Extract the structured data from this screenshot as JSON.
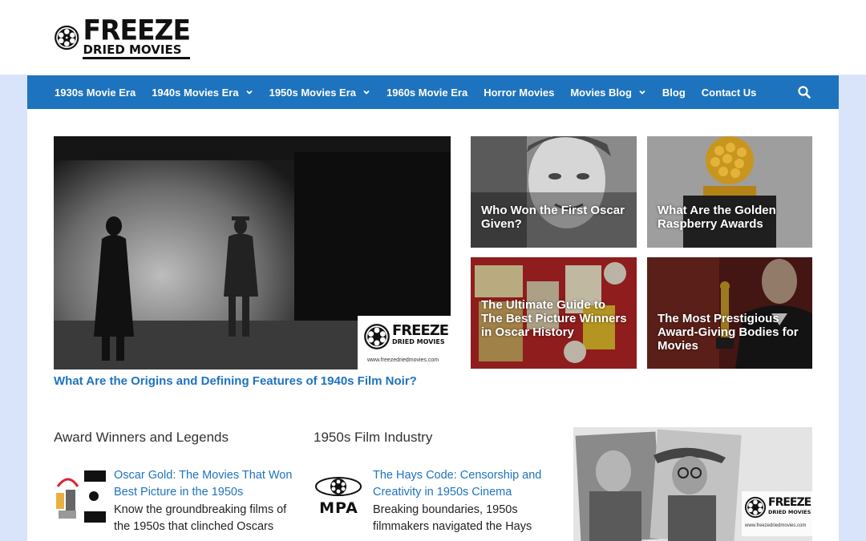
{
  "header": {
    "logo_line1": "FREEZE",
    "logo_line2": "DRIED MOVIES"
  },
  "nav": {
    "items": [
      {
        "label": "1930s Movie Era",
        "dropdown": false
      },
      {
        "label": "1940s Movies Era",
        "dropdown": true
      },
      {
        "label": "1950s Movies Era",
        "dropdown": true
      },
      {
        "label": "1960s Movie Era",
        "dropdown": false
      },
      {
        "label": "Horror Movies",
        "dropdown": false
      },
      {
        "label": "Movies Blog",
        "dropdown": true
      },
      {
        "label": "Blog",
        "dropdown": false
      },
      {
        "label": "Contact Us",
        "dropdown": false
      }
    ],
    "search_icon": "search-icon"
  },
  "featured": {
    "main": {
      "title": "What Are the Origins and Defining Features of 1940s Film Noir?",
      "watermark_line1": "FREEZE",
      "watermark_line2": "DRIED MOVIES",
      "watermark_url": "www.freezedriedmovies.com"
    },
    "tiles": [
      {
        "label": "Who Won the First Oscar Given?"
      },
      {
        "label": "What Are the Golden Raspberry Awards"
      },
      {
        "label": "The Ultimate Guide to The Best Picture Winners in Oscar History"
      },
      {
        "label": "The Most Prestigious Award-Giving Bodies for Movies"
      }
    ]
  },
  "sections": [
    {
      "title": "Award Winners and Legends",
      "post": {
        "title": "Oscar Gold: The Movies That Won Best Picture in the 1950s",
        "excerpt": "Know the groundbreaking films of the 1950s that clinched Oscars"
      }
    },
    {
      "title": "1950s Film Industry",
      "post": {
        "title": "The Hays Code: Censorship and Creativity in 1950s Cinema",
        "excerpt": "Breaking boundaries, 1950s filmmakers navigated the Hays",
        "thumb_text": "MPA"
      }
    }
  ],
  "sidebar_image": {
    "watermark_line1": "FREEZE",
    "watermark_line2": "DRIED MOVIES",
    "watermark_url": "www.freezedriedmovies.com"
  },
  "colors": {
    "nav_bg": "#1e73be",
    "link": "#1e73be",
    "side_bg": "#d9e4fb"
  }
}
